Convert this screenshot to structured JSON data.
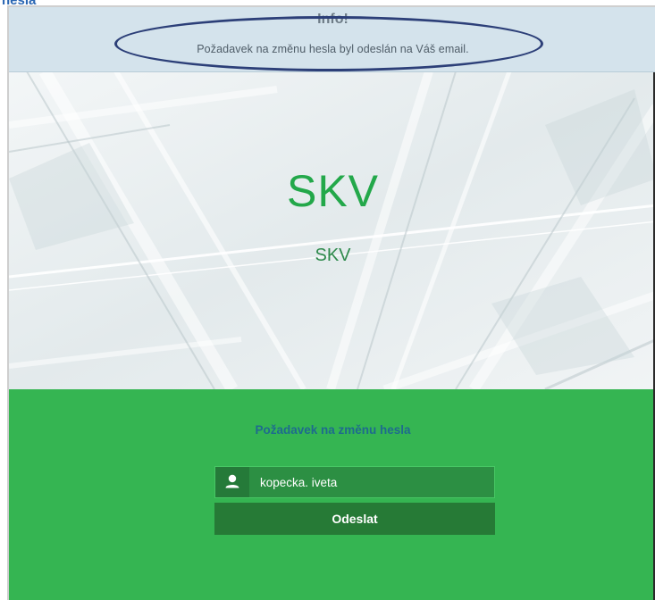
{
  "document": {
    "heading_fragment": "hesla"
  },
  "alert": {
    "title": "Info!",
    "message": "Požadavek na změnu hesla byl odeslán na Váš email."
  },
  "hero": {
    "title": "SKV",
    "subtitle": "SKV"
  },
  "form": {
    "title": "Požadavek na změnu hesla",
    "username_value": "kopecka. iveta",
    "user_icon": "user-icon",
    "submit_label": "Odeslat"
  },
  "colors": {
    "accent_green": "#35b552",
    "hero_text": "#23a84a",
    "alert_bg": "#d4e3ec",
    "annotation": "#2c3f78"
  }
}
